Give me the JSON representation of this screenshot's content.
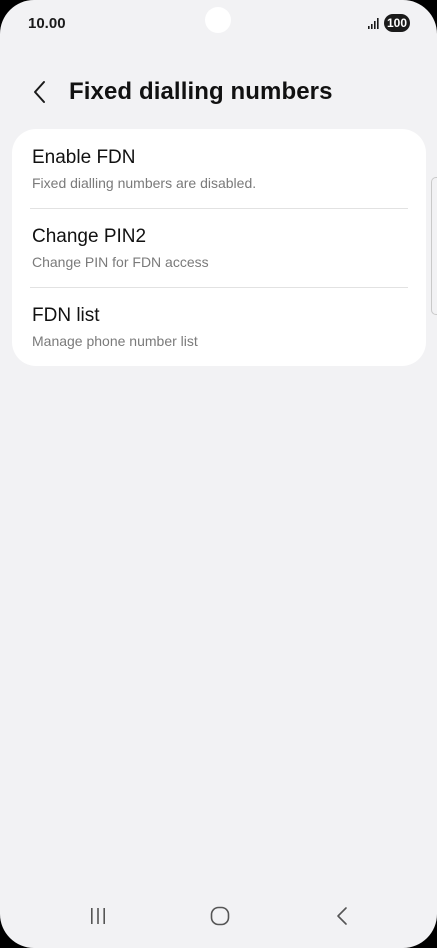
{
  "status_bar": {
    "time": "10.00",
    "battery": "100"
  },
  "header": {
    "title": "Fixed dialling numbers"
  },
  "menu": {
    "items": [
      {
        "title": "Enable FDN",
        "subtitle": "Fixed dialling numbers are disabled."
      },
      {
        "title": "Change PIN2",
        "subtitle": "Change PIN for FDN access"
      },
      {
        "title": "FDN list",
        "subtitle": "Manage phone number list"
      }
    ]
  },
  "nav_bar": {
    "icons": [
      "recent-apps-icon",
      "home-icon",
      "back-icon"
    ]
  },
  "colors": {
    "background": "#f2f2f4",
    "card": "#ffffff",
    "primary_text": "#111111",
    "secondary_text": "#7a7a7a"
  }
}
